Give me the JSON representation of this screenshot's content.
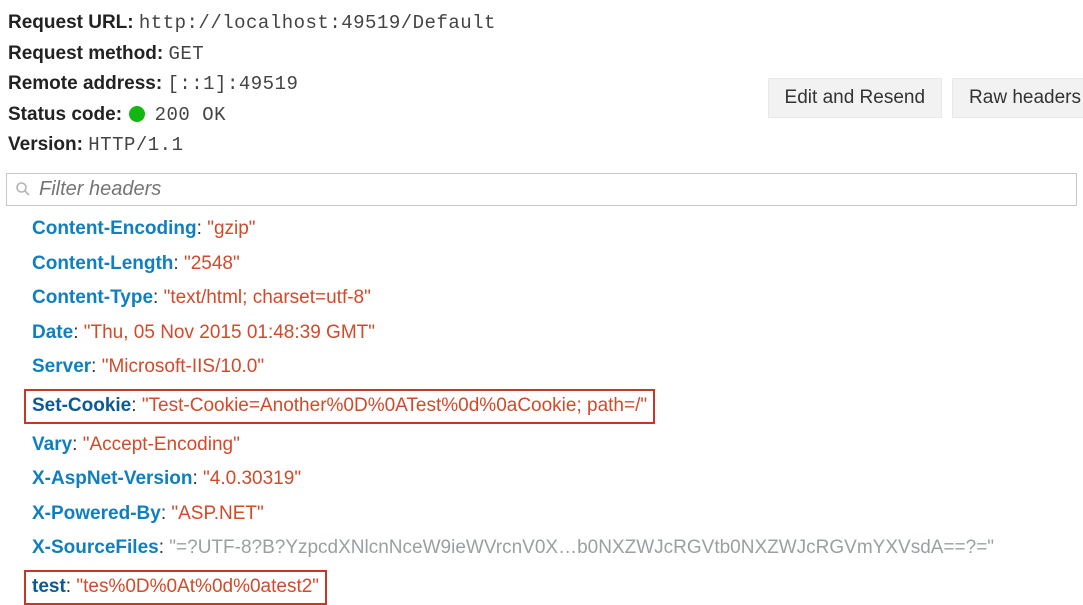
{
  "meta": {
    "url_label": "Request URL:",
    "url_value": "http://localhost:49519/Default",
    "method_label": "Request method:",
    "method_value": "GET",
    "remote_label": "Remote address:",
    "remote_value": "[::1]:49519",
    "status_label": "Status code:",
    "status_value": "200 OK",
    "status_color": "#12b712",
    "version_label": "Version:",
    "version_value": "HTTP/1.1"
  },
  "buttons": {
    "edit_resend": "Edit and Resend",
    "raw_headers": "Raw headers"
  },
  "filter": {
    "placeholder": "Filter headers"
  },
  "headers": [
    {
      "name": "Content-Encoding",
      "value": "\"gzip\"",
      "highlight": false
    },
    {
      "name": "Content-Length",
      "value": "\"2548\"",
      "highlight": false
    },
    {
      "name": "Content-Type",
      "value": "\"text/html; charset=utf-8\"",
      "highlight": false
    },
    {
      "name": "Date",
      "value": "\"Thu, 05 Nov 2015 01:48:39 GMT\"",
      "highlight": false
    },
    {
      "name": "Server",
      "value": "\"Microsoft-IIS/10.0\"",
      "highlight": false
    },
    {
      "name": "Set-Cookie",
      "value": "\"Test-Cookie=Another%0D%0ATest%0d%0aCookie; path=/\"",
      "highlight": true
    },
    {
      "name": "Vary",
      "value": "\"Accept-Encoding\"",
      "highlight": false
    },
    {
      "name": "X-AspNet-Version",
      "value": "\"4.0.30319\"",
      "highlight": false
    },
    {
      "name": "X-Powered-By",
      "value": "\"ASP.NET\"",
      "highlight": false
    },
    {
      "name": "X-SourceFiles",
      "value": "\"=?UTF-8?B?YzpcdXNlcnNceW9ieWVrcnV0X…b0NXZWJcRGVtb0NXZWJcRGVmYXVsdA==?=\"",
      "highlight": false,
      "gray": true
    },
    {
      "name": "test",
      "value": "\"tes%0D%0At%0d%0atest2\"",
      "highlight": true
    }
  ]
}
